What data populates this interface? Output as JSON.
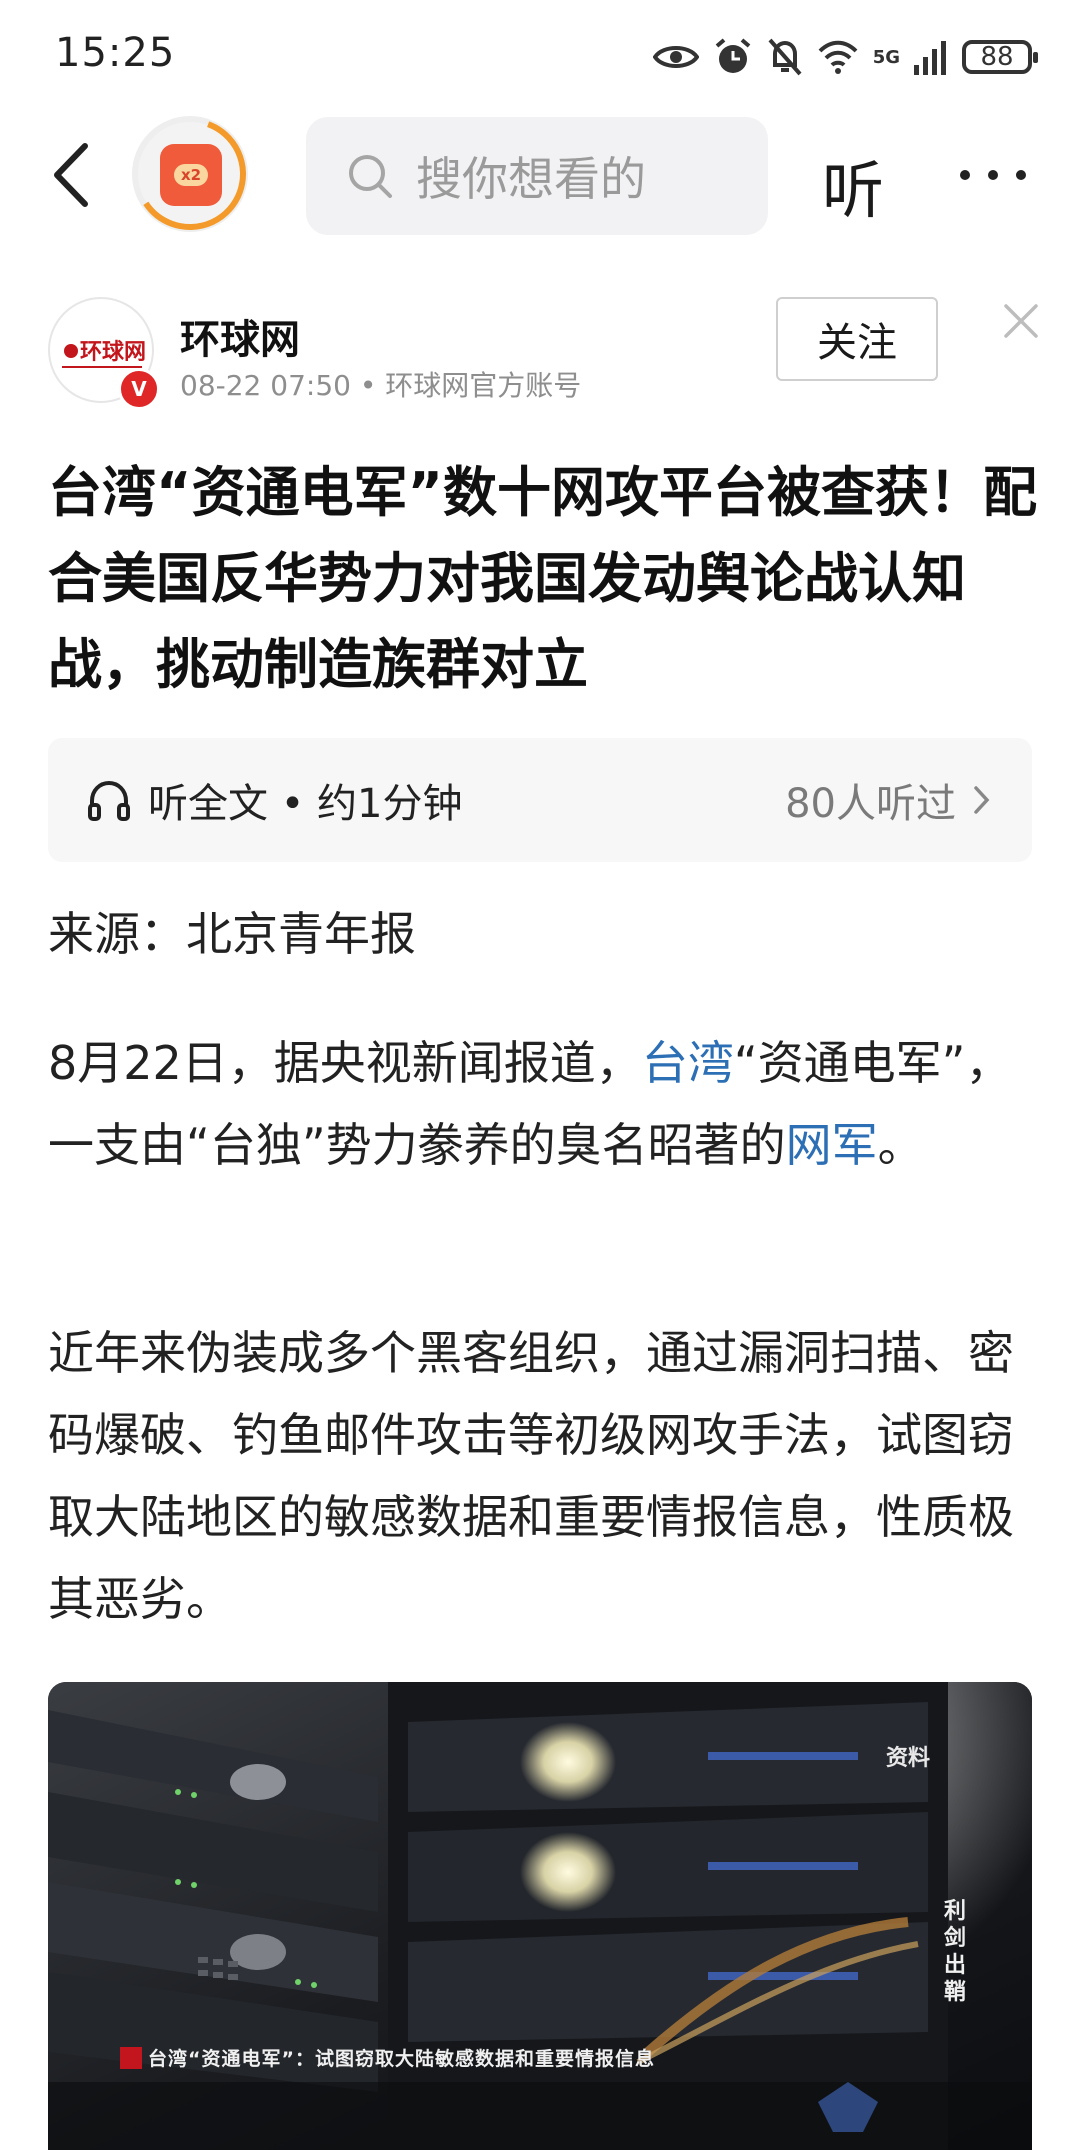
{
  "status_bar": {
    "time": "15:25",
    "network": "5G",
    "battery": "88",
    "icons": [
      "eye-icon",
      "alarm-icon",
      "mute-icon",
      "wifi-icon",
      "signal-icon",
      "battery-icon"
    ]
  },
  "nav": {
    "back_icon": "chevron-left-icon",
    "redpacket_badge": "x2",
    "search_placeholder": "搜你想看的",
    "listen_label": "听",
    "more_icon": "more-dots-icon"
  },
  "author": {
    "logo_text": "环球网",
    "verified_mark": "V",
    "name": "环球网",
    "meta": "08-22 07:50 • 环球网官方账号",
    "follow_label": "关注",
    "dismiss_icon": "close-icon"
  },
  "article": {
    "title": "台湾“资通电军”数十网攻平台被查获！配合美国反华势力对我国发动舆论战认知战，挑动制造族群对立",
    "listen_bar": {
      "label": "听全文 • 约1分钟",
      "listeners": "80人听过"
    },
    "source": "来源：北京青年报",
    "para1": {
      "pre": "8月22日，据央视新闻报道，",
      "link1": "台湾",
      "mid": "“资通电军”，一支由“台独”势力豢养的臭名昭著的",
      "link2": "网军",
      "post": "。"
    },
    "para2": "近年来伪装成多个黑客组织，通过漏洞扫描、密码爆破、钓鱼邮件攻击等初级网攻手法，试图窃取大陆地区的敏感数据和重要情报信息，性质极其恶劣。",
    "image": {
      "caption": "台湾“资通电军”：试图窃取大陆敏感数据和重要情报信息",
      "watermark_top": "资料",
      "watermark_side": "利剑出鞘"
    }
  },
  "colors": {
    "link": "#2c6fb5",
    "verified": "#e02727",
    "redpacket": "#f05b3b",
    "ring": "#f39a2a"
  }
}
